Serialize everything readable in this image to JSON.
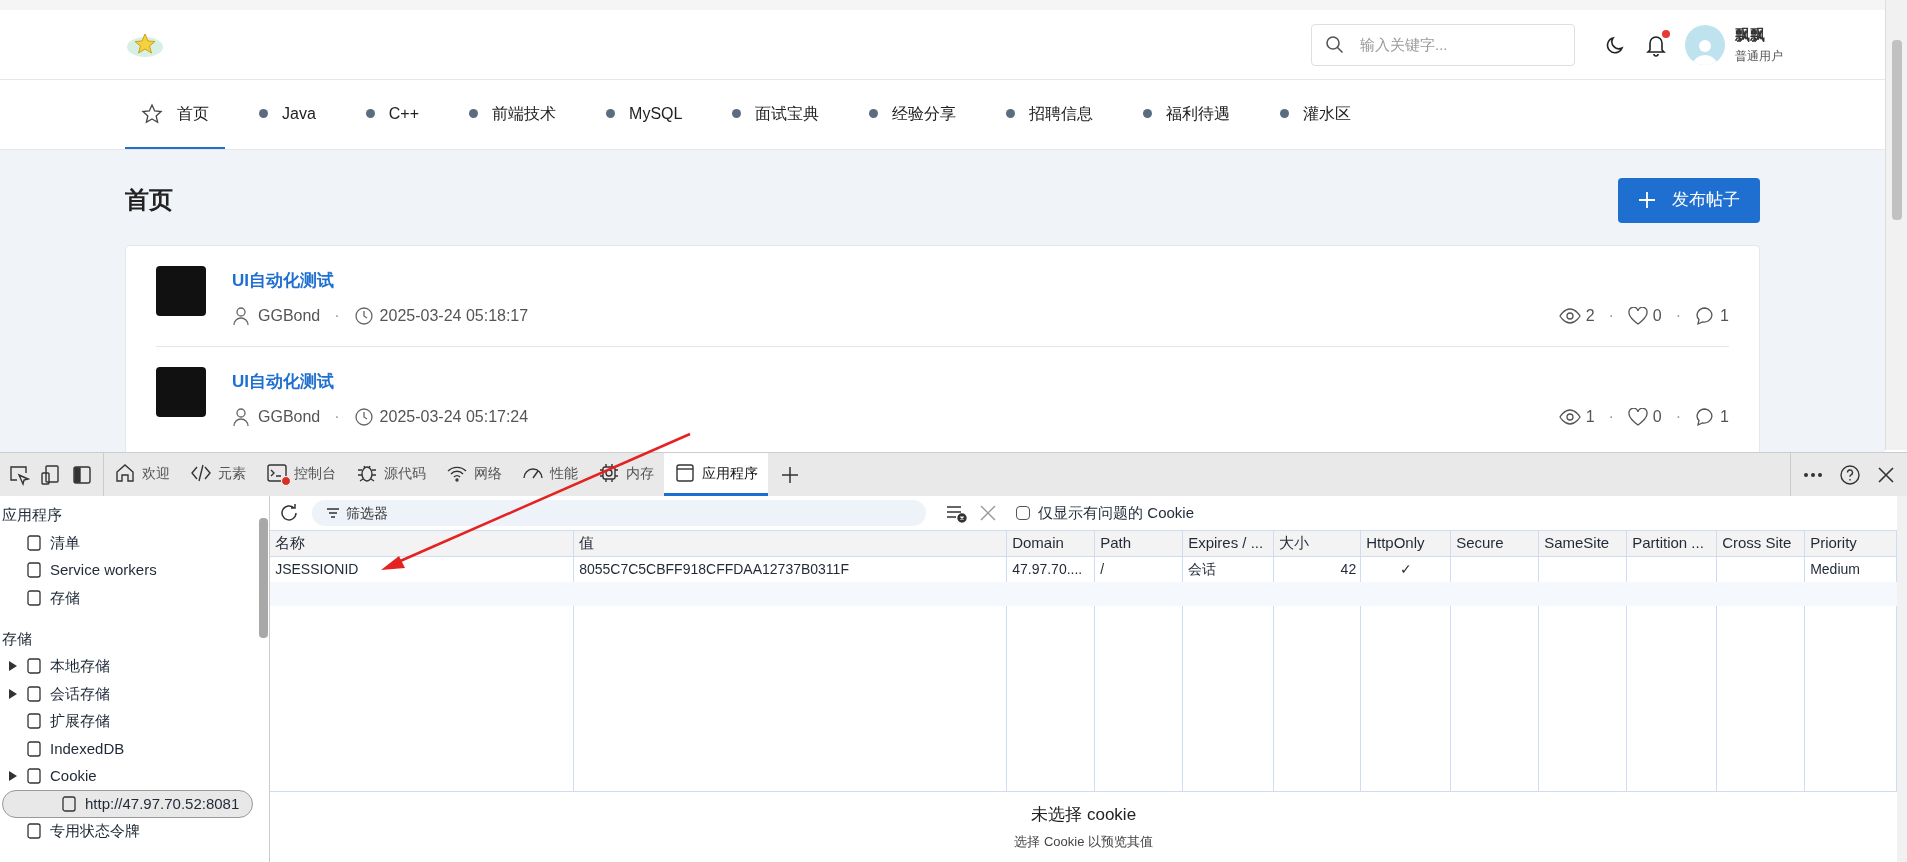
{
  "header": {
    "search": {
      "placeholder": "输入关键字..."
    },
    "notification_dot": true,
    "user": {
      "name": "飘飘",
      "role": "普通用户"
    }
  },
  "nav": [
    {
      "label": "首页",
      "selected": true,
      "kind": "star"
    },
    {
      "label": "Java",
      "selected": false,
      "kind": "dot"
    },
    {
      "label": "C++",
      "selected": false,
      "kind": "dot"
    },
    {
      "label": "前端技术",
      "selected": false,
      "kind": "dot"
    },
    {
      "label": "MySQL",
      "selected": false,
      "kind": "dot"
    },
    {
      "label": "面试宝典",
      "selected": false,
      "kind": "dot"
    },
    {
      "label": "经验分享",
      "selected": false,
      "kind": "dot"
    },
    {
      "label": "招聘信息",
      "selected": false,
      "kind": "dot"
    },
    {
      "label": "福利待遇",
      "selected": false,
      "kind": "dot"
    },
    {
      "label": "灌水区",
      "selected": false,
      "kind": "dot"
    }
  ],
  "page": {
    "title": "首页",
    "publish_button": "发布帖子"
  },
  "posts": [
    {
      "title": "UI自动化测试",
      "author": "GGBond",
      "time": "2025-03-24 05:18:17",
      "views": "2",
      "likes": "0",
      "comments": "1",
      "separators": [
        "·",
        "·",
        "·"
      ]
    },
    {
      "title": "UI自动化测试",
      "author": "GGBond",
      "time": "2025-03-24 05:17:24",
      "views": "1",
      "likes": "0",
      "comments": "1",
      "separators": [
        "·",
        "·",
        "·"
      ]
    }
  ],
  "devtools": {
    "tabs": [
      {
        "label": "欢迎",
        "selected": false,
        "error": false
      },
      {
        "label": "元素",
        "selected": false,
        "error": false
      },
      {
        "label": "控制台",
        "selected": false,
        "error": true
      },
      {
        "label": "源代码",
        "selected": false,
        "error": false
      },
      {
        "label": "网络",
        "selected": false,
        "error": false
      },
      {
        "label": "性能",
        "selected": false,
        "error": false
      },
      {
        "label": "内存",
        "selected": false,
        "error": false
      },
      {
        "label": "应用程序",
        "selected": true,
        "error": false
      }
    ],
    "sidebar": [
      {
        "title": "应用程序",
        "items": [
          {
            "label": "清单",
            "expandable": false,
            "selected": false
          },
          {
            "label": "Service workers",
            "expandable": false,
            "selected": false
          },
          {
            "label": "存储",
            "expandable": false,
            "selected": false
          }
        ]
      },
      {
        "title": "存储",
        "items": [
          {
            "label": "本地存储",
            "expandable": true,
            "selected": false
          },
          {
            "label": "会话存储",
            "expandable": true,
            "selected": false
          },
          {
            "label": "扩展存储",
            "expandable": false,
            "selected": false
          },
          {
            "label": "IndexedDB",
            "expandable": false,
            "selected": false
          },
          {
            "label": "Cookie",
            "expandable": true,
            "selected": false,
            "children": [
              {
                "label": "http://47.97.70.52:8081",
                "expandable": false,
                "selected": true
              }
            ]
          },
          {
            "label": "专用状态令牌",
            "expandable": false,
            "selected": false
          }
        ]
      }
    ],
    "filter": {
      "placeholder": "筛选器"
    },
    "issues_checkbox": {
      "label": "仅显示有问题的 Cookie",
      "checked": false
    },
    "columns": [
      "名称",
      "值",
      "Domain",
      "Path",
      "Expires / ...",
      "大小",
      "HttpOnly",
      "Secure",
      "SameSite",
      "Partition ...",
      "Cross Site",
      "Priority"
    ],
    "rows": [
      {
        "cells": [
          "JSESSIONID",
          "8055C7C5CBFF918CFFDAA12737B0311F",
          "47.97.70....",
          "/",
          "会话",
          "42",
          "✓",
          null,
          null,
          null,
          null,
          "Medium"
        ]
      }
    ],
    "preview": {
      "title": "未选择 cookie",
      "hint": "选择 Cookie 以预览其值"
    }
  }
}
